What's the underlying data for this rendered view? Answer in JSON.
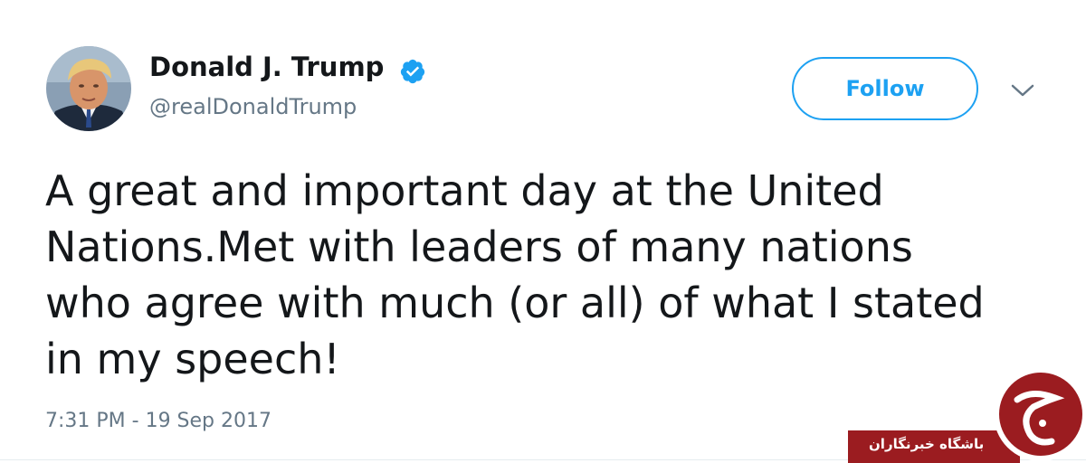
{
  "tweet": {
    "author": {
      "display_name": "Donald J. Trump",
      "handle": "@realDonaldTrump",
      "verified": true,
      "avatar_icon": "profile-photo"
    },
    "follow_label": "Follow",
    "menu_icon": "chevron-down-icon",
    "text_lines": [
      "A great and important day at the United",
      "Nations.Met with leaders of many nations",
      "who agree with much (or all) of what I stated",
      "in my speech!"
    ],
    "timestamp": "7:31 PM - 19 Sep 2017"
  },
  "watermark": {
    "text": "باشگاه خبرنگاران",
    "logo_glyph": "ج",
    "color": "#9b1c20"
  },
  "colors": {
    "accent": "#1da1f2",
    "text_primary": "#14171a",
    "text_secondary": "#657786",
    "divider": "#e6ecf0"
  }
}
